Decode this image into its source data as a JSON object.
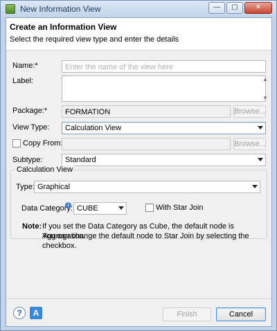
{
  "window": {
    "title": "New Information View",
    "minimize_glyph": "—",
    "maximize_glyph": "▢",
    "close_glyph": "✕"
  },
  "header": {
    "title": "Create an Information View",
    "subtitle": "Select the required view type and enter the details"
  },
  "form": {
    "name_label": "Name:*",
    "name_placeholder": "Enter the name of the view here",
    "label_label": "Label:",
    "package_label": "Package:*",
    "package_value": "FORMATION",
    "package_browse": "Browse...",
    "view_type_label": "View Type:",
    "view_type_value": "Calculation View",
    "copy_from_label": "Copy From:",
    "copy_from_browse": "Browse...",
    "subtype_label": "Subtype:",
    "subtype_value": "Standard"
  },
  "calc_view": {
    "group_title": "Calculation View",
    "type_label": "Type:",
    "type_value": "Graphical",
    "data_category_label": "Data Category:",
    "data_category_value": "CUBE",
    "star_join_label": "With Star Join",
    "note_label": "Note:",
    "note_line1": "If you set the Data Category as Cube, the default node is Aggregation.",
    "note_line2": "You can change the default node to Star Join by selecting the checkbox."
  },
  "footer": {
    "help_glyph": "?",
    "assist_glyph": "A",
    "finish_label": "Finish",
    "cancel_label": "Cancel"
  },
  "colors": {
    "focus_border": "#7a9bd0",
    "title_bar": "#c3d4ea"
  }
}
